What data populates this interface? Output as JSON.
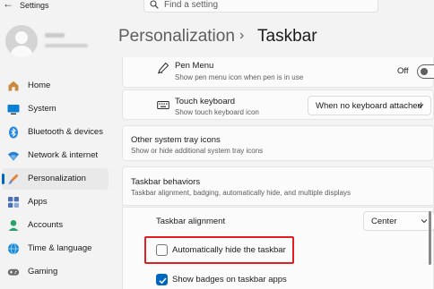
{
  "window": {
    "title": "Settings"
  },
  "search": {
    "placeholder": "Find a setting"
  },
  "breadcrumb": {
    "parent": "Personalization",
    "separator": "›",
    "current": "Taskbar"
  },
  "sidebar": {
    "items": [
      {
        "label": "Home",
        "icon": "home-icon"
      },
      {
        "label": "System",
        "icon": "system-icon"
      },
      {
        "label": "Bluetooth & devices",
        "icon": "bluetooth-icon"
      },
      {
        "label": "Network & internet",
        "icon": "wifi-icon"
      },
      {
        "label": "Personalization",
        "icon": "brush-icon",
        "selected": true
      },
      {
        "label": "Apps",
        "icon": "apps-icon"
      },
      {
        "label": "Accounts",
        "icon": "accounts-icon"
      },
      {
        "label": "Time & language",
        "icon": "globe-icon"
      },
      {
        "label": "Gaming",
        "icon": "gamepad-icon"
      }
    ]
  },
  "pen_menu": {
    "title": "Pen Menu",
    "subtitle": "Show pen menu icon when pen is in use",
    "toggle_label": "Off",
    "toggle_on": false
  },
  "touch_keyboard": {
    "title": "Touch keyboard",
    "subtitle": "Show touch keyboard icon",
    "value": "When no keyboard attached"
  },
  "tray_icons": {
    "title": "Other system tray icons",
    "subtitle": "Show or hide additional system tray icons"
  },
  "behaviors": {
    "title": "Taskbar behaviors",
    "subtitle": "Taskbar alignment, badging, automatically hide, and multiple displays",
    "alignment_label": "Taskbar alignment",
    "alignment_value": "Center",
    "auto_hide_label": "Automatically hide the taskbar",
    "auto_hide_checked": false,
    "badges_label": "Show badges on taskbar apps",
    "badges_checked": true
  },
  "colors": {
    "accent": "#0067c0",
    "highlight": "#e02020"
  }
}
